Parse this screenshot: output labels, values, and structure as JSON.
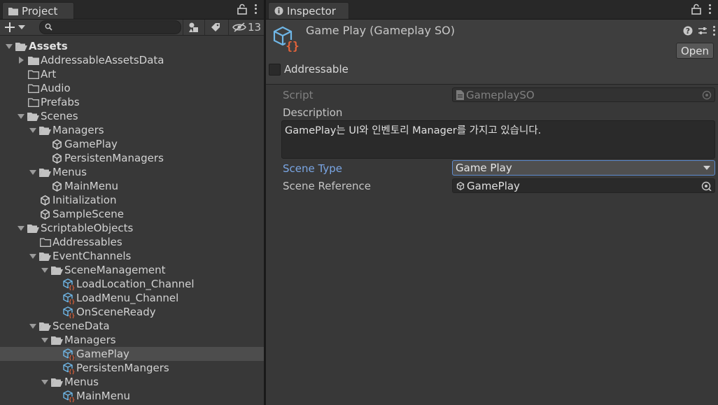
{
  "project": {
    "tab_label": "Project",
    "hidden_count": "13",
    "tree": [
      {
        "label": "Assets",
        "depth": 0,
        "type": "folder-open",
        "arrow": "down",
        "bold": true
      },
      {
        "label": "AddressableAssetsData",
        "depth": 1,
        "type": "folder",
        "arrow": "right"
      },
      {
        "label": "Art",
        "depth": 1,
        "type": "folder-empty",
        "arrow": "none"
      },
      {
        "label": "Audio",
        "depth": 1,
        "type": "folder-empty",
        "arrow": "none"
      },
      {
        "label": "Prefabs",
        "depth": 1,
        "type": "folder-empty",
        "arrow": "none"
      },
      {
        "label": "Scenes",
        "depth": 1,
        "type": "folder-open",
        "arrow": "down"
      },
      {
        "label": "Managers",
        "depth": 2,
        "type": "folder-open",
        "arrow": "down"
      },
      {
        "label": "GamePlay",
        "depth": 3,
        "type": "unity",
        "arrow": "none"
      },
      {
        "label": "PersistenManagers",
        "depth": 3,
        "type": "unity",
        "arrow": "none"
      },
      {
        "label": "Menus",
        "depth": 2,
        "type": "folder-open",
        "arrow": "down"
      },
      {
        "label": "MainMenu",
        "depth": 3,
        "type": "unity",
        "arrow": "none"
      },
      {
        "label": "Initialization",
        "depth": 2,
        "type": "unity",
        "arrow": "none"
      },
      {
        "label": "SampleScene",
        "depth": 2,
        "type": "unity",
        "arrow": "none"
      },
      {
        "label": "ScriptableObjects",
        "depth": 1,
        "type": "folder-open",
        "arrow": "down"
      },
      {
        "label": "Addressables",
        "depth": 2,
        "type": "folder-empty",
        "arrow": "none"
      },
      {
        "label": "EventChannels",
        "depth": 2,
        "type": "folder-open",
        "arrow": "down"
      },
      {
        "label": "SceneManagement",
        "depth": 3,
        "type": "folder-open",
        "arrow": "down"
      },
      {
        "label": "LoadLocation_Channel",
        "depth": 4,
        "type": "so",
        "arrow": "none"
      },
      {
        "label": "LoadMenu_Channel",
        "depth": 4,
        "type": "so",
        "arrow": "none"
      },
      {
        "label": "OnSceneReady",
        "depth": 4,
        "type": "so",
        "arrow": "none"
      },
      {
        "label": "SceneData",
        "depth": 2,
        "type": "folder-open",
        "arrow": "down"
      },
      {
        "label": "Managers",
        "depth": 3,
        "type": "folder-open",
        "arrow": "down"
      },
      {
        "label": "GamePlay",
        "depth": 4,
        "type": "so",
        "arrow": "none",
        "selected": true
      },
      {
        "label": "PersistenMangers",
        "depth": 4,
        "type": "so",
        "arrow": "none"
      },
      {
        "label": "Menus",
        "depth": 3,
        "type": "folder-open",
        "arrow": "down"
      },
      {
        "label": "MainMenu",
        "depth": 4,
        "type": "so",
        "arrow": "none"
      }
    ]
  },
  "inspector": {
    "tab_label": "Inspector",
    "title": "Game Play (Gameplay SO)",
    "open_label": "Open",
    "addressable_label": "Addressable",
    "script_label": "Script",
    "script_value": "GameplaySO",
    "description_label": "Description",
    "description_value": "GamePlay는 UI와 인벤토리 Manager를 가지고 있습니다.",
    "scene_type_label": "Scene Type",
    "scene_type_value": "Game Play",
    "scene_ref_label": "Scene Reference",
    "scene_ref_value": "GamePlay"
  },
  "colors": {
    "panel_bg": "#383838",
    "selection": "#4d4d4d",
    "accent_blue": "#7aa6e4",
    "so_icon_blue": "#6fb6e6",
    "so_icon_orange": "#e8643a"
  },
  "icons": [
    "folder-icon",
    "unity-scene-icon",
    "scriptable-object-icon",
    "lock-icon",
    "kebab-menu-icon",
    "search-icon",
    "help-icon",
    "preset-icon",
    "dropdown-caret-icon",
    "target-icon"
  ]
}
